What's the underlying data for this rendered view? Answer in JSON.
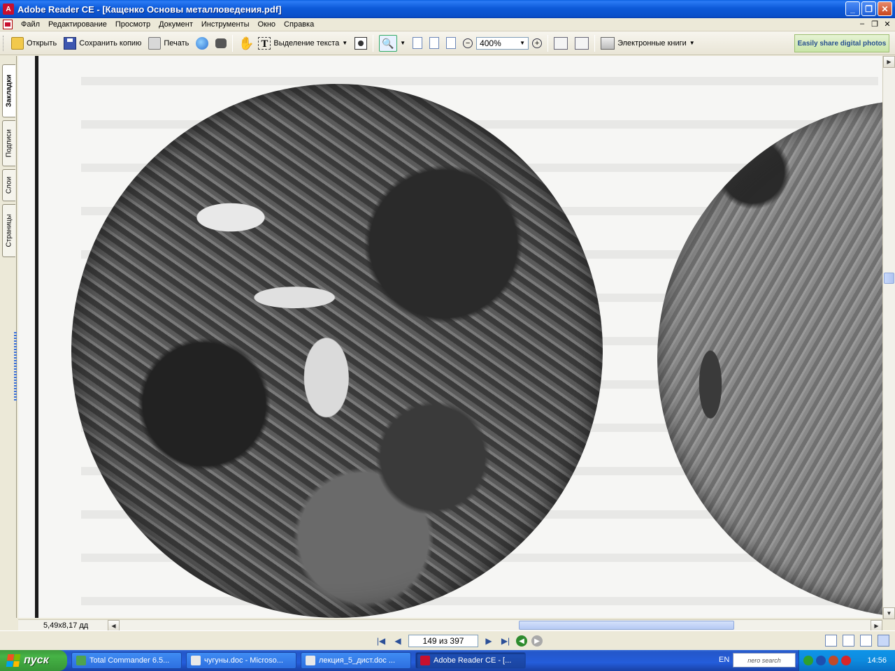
{
  "window": {
    "title": "Adobe Reader CE - [Кащенко Основы металловедения.pdf]",
    "app_icon": "adobe-reader-icon"
  },
  "menu": {
    "items": [
      "Файл",
      "Редактирование",
      "Просмотр",
      "Документ",
      "Инструменты",
      "Окно",
      "Справка"
    ]
  },
  "toolbar": {
    "open_label": "Открыть",
    "save_copy_label": "Сохранить копию",
    "print_label": "Печать",
    "select_text_label": "Выделение текста",
    "zoom_value": "400%",
    "ebooks_label": "Электронные книги",
    "promo_label": "Easily share digital photos"
  },
  "side_tabs": {
    "bookmarks": "Закладки",
    "signatures": "Подписи",
    "layers": "Слои",
    "pages": "Страницы"
  },
  "status": {
    "page_size": "5,49x8,17 дд",
    "page_indicator": "149 из 397"
  },
  "taskbar": {
    "start_label": "пуск",
    "tasks": [
      {
        "label": "Total Commander 6.5...",
        "icon": "total-commander-icon"
      },
      {
        "label": "чугуны.doc - Microso...",
        "icon": "word-doc-icon"
      },
      {
        "label": "лекция_5_дист.doc ...",
        "icon": "word-doc-icon"
      },
      {
        "label": "Adobe Reader CE - [...",
        "icon": "adobe-reader-icon"
      }
    ],
    "language": "EN",
    "nero_label": "nero search",
    "clock": "14:56"
  },
  "colors": {
    "titlebar": "#0A4FC9",
    "taskbar": "#245DDB",
    "start": "#46B346",
    "chrome": "#ECE9D8"
  }
}
